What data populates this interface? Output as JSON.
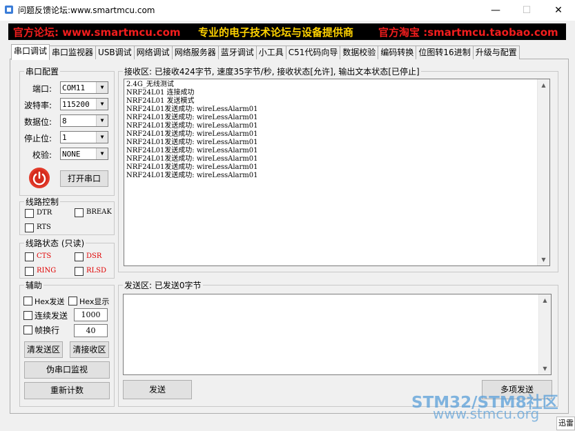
{
  "window": {
    "title": "问题反馈论坛:www.smartmcu.com",
    "minimize": "—",
    "maximize": "☐",
    "close": "✕"
  },
  "banner": {
    "left": "官方论坛: www.smartmcu.com",
    "center": "专业的电子技术论坛与设备提供商",
    "right": "官方淘宝 :smartmcu.taobao.com"
  },
  "tabs": [
    "串口调试",
    "串口监视器",
    "USB调试",
    "网络调试",
    "网络服务器",
    "蓝牙调试",
    "小工具",
    "C51代码向导",
    "数据校验",
    "编码转换",
    "位图转16进制",
    "升级与配置"
  ],
  "serial_config": {
    "title": "串口配置",
    "port_label": "端口:",
    "port_value": "COM11",
    "baud_label": "波特率:",
    "baud_value": "115200",
    "databits_label": "数据位:",
    "databits_value": "8",
    "stopbits_label": "停止位:",
    "stopbits_value": "1",
    "parity_label": "校验:",
    "parity_value": "NONE",
    "open_button": "打开串口"
  },
  "line_control": {
    "title": "线路控制",
    "dtr": "DTR",
    "break": "BREAK",
    "rts": "RTS"
  },
  "line_status": {
    "title": "线路状态 (只读)",
    "cts": "CTS",
    "dsr": "DSR",
    "ring": "RING",
    "rlsd": "RLSD",
    "status_color": "#e00000"
  },
  "assist": {
    "title": "辅助",
    "hex_send": "Hex发送",
    "hex_show": "Hex显示",
    "auto_send": "连续发送",
    "auto_send_value": "1000",
    "frame_newline": "帧换行",
    "frame_value": "40",
    "clear_send": "清发送区",
    "clear_recv": "清接收区",
    "fake_monitor": "伪串口监视",
    "reset_count": "重新计数"
  },
  "receive": {
    "label": "接收区: 已接收424字节, 速度35字节/秒, 接收状态[允许], 输出文本状态[已停止]",
    "lines": [
      "2.4G_无线测试",
      "NRF24L01 连接成功",
      "NRF24L01 发送模式",
      "NRF24L01发送成功: wireLessAlarm01",
      "NRF24L01发送成功: wireLessAlarm01",
      "NRF24L01发送成功: wireLessAlarm01",
      "NRF24L01发送成功: wireLessAlarm01",
      "NRF24L01发送成功: wireLessAlarm01",
      "NRF24L01发送成功: wireLessAlarm01",
      "NRF24L01发送成功: wireLessAlarm01",
      "NRF24L01发送成功: wireLessAlarm01",
      "NRF24L01发送成功: wireLessAlarm01"
    ]
  },
  "send": {
    "label": "发送区: 已发送0字节",
    "send_button": "发送",
    "multi_send_button": "多项发送"
  },
  "watermark": {
    "line1": "STM32/STM8社区",
    "line2": "www.stmcu.org"
  },
  "side_tag": "迅雷"
}
